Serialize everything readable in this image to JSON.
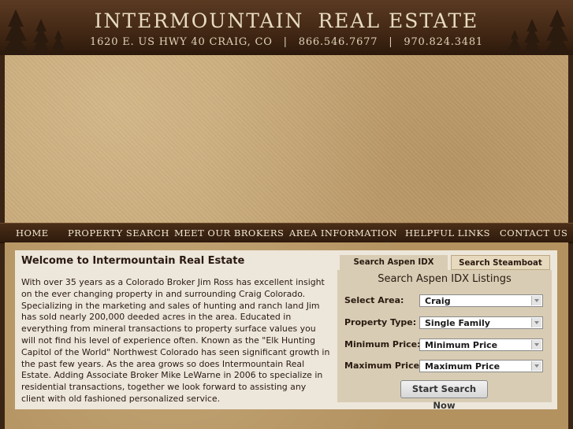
{
  "header": {
    "title_left": "INTERMOUNTAIN",
    "title_right": "REAL ESTATE",
    "address": "1620 E. US HWY 40 CRAIG, CO",
    "phone1": "866.546.7677",
    "phone2": "970.824.3481",
    "separator": "|"
  },
  "nav": {
    "items": [
      "HOME",
      "PROPERTY SEARCH",
      "MEET OUR BROKERS",
      "AREA INFORMATION",
      "HELPFUL LINKS",
      "CONTACT US"
    ]
  },
  "welcome": {
    "title": "Welcome to Intermountain Real Estate",
    "body": "With over 35 years as a Colorado Broker Jim Ross has excellent insight on the ever changing property in and surrounding Craig Colorado. Specializing in the marketing and sales of hunting and ranch land Jim has sold nearly 200,000 deeded acres in the area. Educated in everything from mineral transactions to property surface values you will not find his level of experience often. Known as the \"Elk Hunting Capitol of the World\" Northwest Colorado has seen significant growth in the past few years. As the area grows so does Intermountain Real Estate. Adding Associate Broker Mike LeWarne in 2006 to specialize in residential transactions, together we look forward to assisting any client with old fashioned personalized service."
  },
  "search": {
    "tabs": [
      "Search Aspen IDX",
      "Search Steamboat IDX"
    ],
    "panel_title": "Search Aspen IDX Listings",
    "fields": [
      {
        "label": "Select Area:",
        "value": "Craig"
      },
      {
        "label": "Property Type:",
        "value": "Single Family"
      },
      {
        "label": "Minimum Price:",
        "value": "Minimum Price"
      },
      {
        "label": "Maximum Price:",
        "value": "Maximum Price"
      }
    ],
    "button": "Start Search Now"
  },
  "colors": {
    "header_bg": "#3d2412",
    "banner_bg": "#c4a474",
    "content_bg": "#ede6da",
    "panel_bg": "#d8ccb4",
    "text": "#2a1a10"
  }
}
